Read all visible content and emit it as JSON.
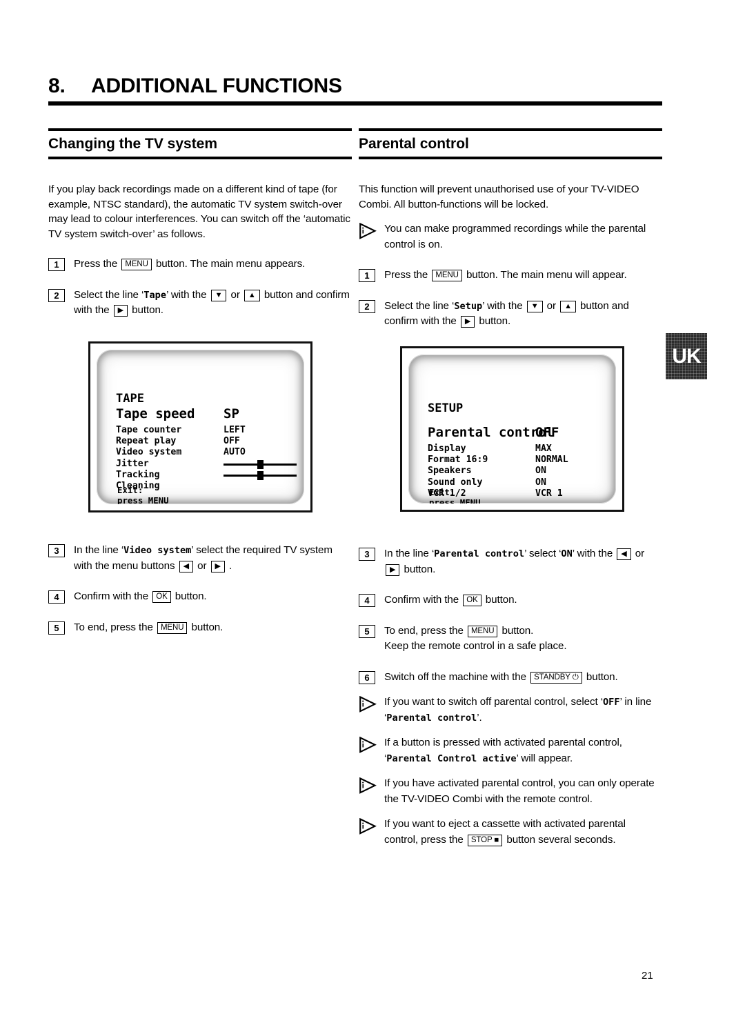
{
  "chapter": {
    "number": "8.",
    "title": "ADDITIONAL FUNCTIONS"
  },
  "left_column": {
    "heading": "Changing the TV system",
    "intro": "If you play back recordings made on a different kind of tape (for example, NTSC standard), the automatic TV system switch-over may lead to colour interferences. You can switch off the ‘automatic TV system switch-over’ as follows.",
    "steps": [
      {
        "number": "1",
        "parts": [
          {
            "t": "text",
            "v": "Press the "
          },
          {
            "t": "key",
            "v": "MENU"
          },
          {
            "t": "text",
            "v": " button. The main menu appears."
          }
        ]
      },
      {
        "number": "2",
        "parts": [
          {
            "t": "text",
            "v": "Select the line ‘"
          },
          {
            "t": "mono",
            "v": "Tape"
          },
          {
            "t": "text",
            "v": "’ with the "
          },
          {
            "t": "key",
            "v": "▼"
          },
          {
            "t": "text",
            "v": " or "
          },
          {
            "t": "key",
            "v": "▲"
          },
          {
            "t": "text",
            "v": " button and confirm with the "
          },
          {
            "t": "key",
            "v": "▶"
          },
          {
            "t": "text",
            "v": " button."
          }
        ]
      },
      {
        "number": "3",
        "parts": [
          {
            "t": "text",
            "v": "In the line ‘"
          },
          {
            "t": "mono",
            "v": "Video system"
          },
          {
            "t": "text",
            "v": "’ select the required TV system with the menu buttons "
          },
          {
            "t": "key",
            "v": "◀"
          },
          {
            "t": "text",
            "v": " or "
          },
          {
            "t": "key",
            "v": "▶"
          },
          {
            "t": "text",
            "v": " ."
          }
        ]
      },
      {
        "number": "4",
        "parts": [
          {
            "t": "text",
            "v": "Confirm with the "
          },
          {
            "t": "key",
            "v": "OK"
          },
          {
            "t": "text",
            "v": " button."
          }
        ]
      },
      {
        "number": "5",
        "parts": [
          {
            "t": "text",
            "v": "To end, press the "
          },
          {
            "t": "key",
            "v": "MENU"
          },
          {
            "t": "text",
            "v": " button."
          }
        ]
      }
    ]
  },
  "right_column": {
    "heading": "Parental control",
    "intro": "This function will prevent unauthorised use of your TV-VIDEO Combi. All button-functions will be locked.",
    "intro_note": {
      "icon": "info-triangle-icon",
      "parts": [
        {
          "t": "text",
          "v": "You can make programmed recordings while the parental control is on."
        }
      ]
    },
    "steps": [
      {
        "number": "1",
        "parts": [
          {
            "t": "text",
            "v": "Press the "
          },
          {
            "t": "key",
            "v": "MENU"
          },
          {
            "t": "text",
            "v": " button. The main menu will appear."
          }
        ]
      },
      {
        "number": "2",
        "parts": [
          {
            "t": "text",
            "v": "Select the line ‘"
          },
          {
            "t": "mono",
            "v": "Setup"
          },
          {
            "t": "text",
            "v": "’ with the "
          },
          {
            "t": "key",
            "v": "▼"
          },
          {
            "t": "text",
            "v": " or "
          },
          {
            "t": "key",
            "v": "▲"
          },
          {
            "t": "text",
            "v": " button and confirm with the "
          },
          {
            "t": "key",
            "v": "▶"
          },
          {
            "t": "text",
            "v": " button."
          }
        ]
      },
      {
        "number": "3",
        "parts": [
          {
            "t": "text",
            "v": "In the line ‘"
          },
          {
            "t": "mono",
            "v": "Parental control"
          },
          {
            "t": "text",
            "v": "’ select ‘"
          },
          {
            "t": "mono",
            "v": "ON"
          },
          {
            "t": "text",
            "v": "’ with the "
          },
          {
            "t": "key",
            "v": "◀"
          },
          {
            "t": "text",
            "v": " or "
          },
          {
            "t": "key",
            "v": "▶"
          },
          {
            "t": "text",
            "v": " button."
          }
        ]
      },
      {
        "number": "4",
        "parts": [
          {
            "t": "text",
            "v": "Confirm with the "
          },
          {
            "t": "key",
            "v": "OK"
          },
          {
            "t": "text",
            "v": " button."
          }
        ]
      },
      {
        "number": "5",
        "parts": [
          {
            "t": "text",
            "v": "To end, press the "
          },
          {
            "t": "key",
            "v": "MENU"
          },
          {
            "t": "text",
            "v": " button."
          },
          {
            "t": "br"
          },
          {
            "t": "text",
            "v": "Keep the remote control in a safe place."
          }
        ]
      },
      {
        "number": "6",
        "parts": [
          {
            "t": "text",
            "v": "Switch off the machine with the "
          },
          {
            "t": "key",
            "v": "STANDBY ⏻"
          },
          {
            "t": "text",
            "v": " button."
          }
        ]
      }
    ],
    "notes": [
      {
        "icon": "info-triangle-icon",
        "parts": [
          {
            "t": "text",
            "v": "If you want to switch off parental control, select ‘"
          },
          {
            "t": "mono",
            "v": "OFF"
          },
          {
            "t": "text",
            "v": "’ in line ‘"
          },
          {
            "t": "mono",
            "v": "Parental control"
          },
          {
            "t": "text",
            "v": "’."
          }
        ]
      },
      {
        "icon": "info-triangle-icon",
        "parts": [
          {
            "t": "text",
            "v": "If a button is pressed with activated parental control, ‘"
          },
          {
            "t": "mono",
            "v": "Parental Control active"
          },
          {
            "t": "text",
            "v": "’ will appear."
          }
        ]
      },
      {
        "icon": "info-triangle-icon",
        "parts": [
          {
            "t": "text",
            "v": "If you have activated parental control, you can only operate the TV-VIDEO Combi with the remote control."
          }
        ]
      },
      {
        "icon": "info-triangle-icon",
        "parts": [
          {
            "t": "text",
            "v": "If you want to eject a cassette with activated parental control, press the "
          },
          {
            "t": "key",
            "v": "STOP ■"
          },
          {
            "t": "text",
            "v": " button several seconds."
          }
        ]
      }
    ]
  },
  "tv_tape": {
    "title": "TAPE",
    "first_row": {
      "label": "Tape speed",
      "value": "SP"
    },
    "rows": [
      {
        "label": "Tape counter",
        "value": "LEFT",
        "type": "text"
      },
      {
        "label": "Repeat play",
        "value": "OFF",
        "type": "text"
      },
      {
        "label": "Video system",
        "value": "AUTO",
        "type": "text"
      },
      {
        "label": "Jitter",
        "value": "",
        "type": "slider"
      },
      {
        "label": "Tracking",
        "value": "",
        "type": "slider"
      },
      {
        "label": "Cleaning",
        "value": "",
        "type": "text"
      }
    ],
    "exit_line1": "Exit:",
    "exit_line2": "press MENU"
  },
  "tv_setup": {
    "title": "SETUP",
    "first_row": {
      "label": "Parental control",
      "value": "OFF"
    },
    "rows": [
      {
        "label": "Display",
        "value": "MAX",
        "type": "text"
      },
      {
        "label": "Format 16:9",
        "value": "NORMAL",
        "type": "text"
      },
      {
        "label": "Speakers",
        "value": "ON",
        "type": "text"
      },
      {
        "label": "Sound only",
        "value": "ON",
        "type": "text"
      },
      {
        "label": "VCR 1/2",
        "value": "VCR 1",
        "type": "text"
      }
    ],
    "exit_line1": "Exit:",
    "exit_line2": "press MENU"
  },
  "language_tab": {
    "label": "UK"
  },
  "page_number": "21"
}
